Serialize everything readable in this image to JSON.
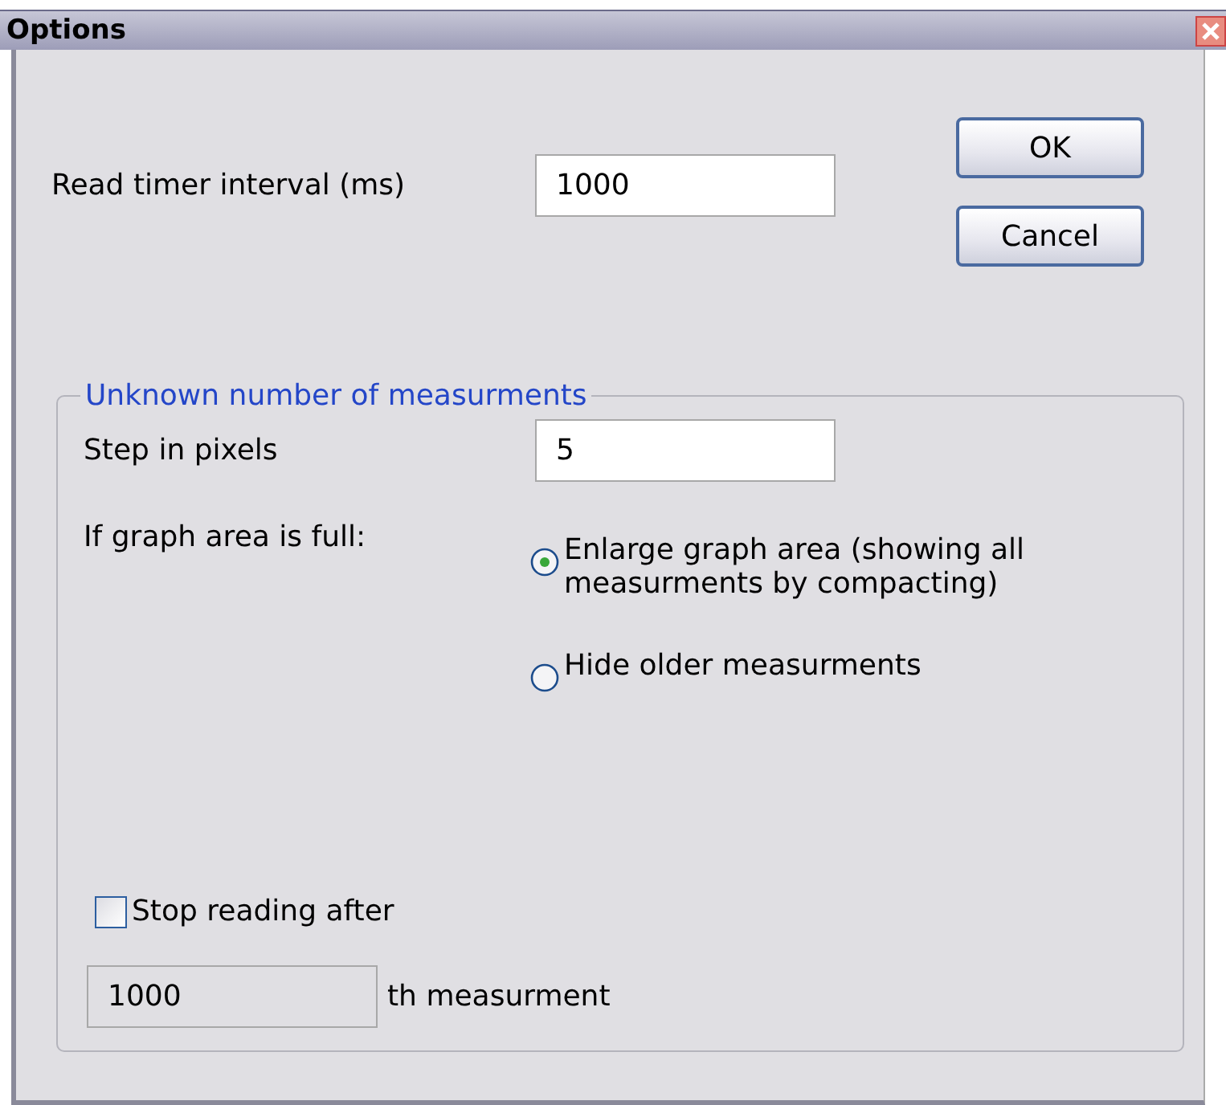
{
  "window": {
    "title": "Options"
  },
  "interval": {
    "label": "Read timer interval (ms)",
    "value": "1000"
  },
  "buttons": [
    {
      "label": "OK"
    },
    {
      "label": "Cancel"
    }
  ],
  "group": {
    "legend": "Unknown number of measurments",
    "step": {
      "label": "Step in pixels",
      "value": "5"
    },
    "full_label": "If graph area is full:",
    "options": [
      {
        "label": "Enlarge graph area (showing all measurments by compacting)",
        "selected": true
      },
      {
        "label": "Hide older measurments",
        "selected": false
      }
    ],
    "stop": {
      "label": "Stop reading after",
      "checked": false
    },
    "stop_count": {
      "value": "1000",
      "suffix": "th measurment",
      "disabled": true
    }
  }
}
